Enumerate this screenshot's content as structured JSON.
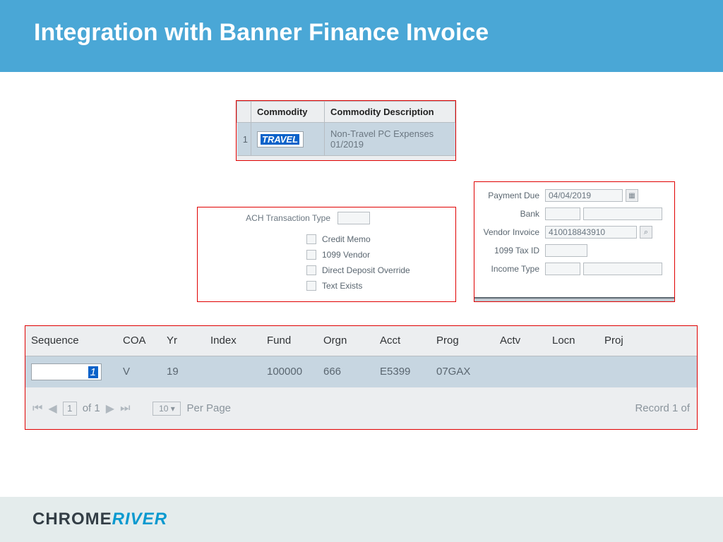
{
  "title": "Integration with Banner Finance Invoice",
  "commodity": {
    "headers": {
      "code": "Commodity",
      "desc": "Commodity Description"
    },
    "row": {
      "seq": "1",
      "code": "TRAVEL",
      "desc": "Non-Travel PC Expenses 01/2019"
    }
  },
  "ach": {
    "label": "ACH Transaction Type",
    "checks": [
      "Credit Memo",
      "1099 Vendor",
      "Direct Deposit Override",
      "Text Exists"
    ]
  },
  "payment": {
    "labels": {
      "due": "Payment Due",
      "bank": "Bank",
      "vendor": "Vendor Invoice",
      "taxid": "1099 Tax ID",
      "income": "Income Type"
    },
    "values": {
      "due": "04/04/2019",
      "vendor": "410018843910"
    }
  },
  "accounting": {
    "headers": [
      "Sequence",
      "COA",
      "Yr",
      "Index",
      "Fund",
      "Orgn",
      "Acct",
      "Prog",
      "Actv",
      "Locn",
      "Proj"
    ],
    "row": {
      "seq": "1",
      "coa": "V",
      "yr": "19",
      "index": "",
      "fund": "100000",
      "orgn": "666",
      "acct": "E5399",
      "prog": "07GAX",
      "actv": "",
      "locn": "",
      "proj": ""
    },
    "pager": {
      "page": "1",
      "of": "of 1",
      "rpp": "10 ▾",
      "perpage": "Per Page",
      "record": "Record 1 of"
    }
  },
  "footer": {
    "brand_a": "CHROME",
    "brand_b": "RIVER"
  }
}
